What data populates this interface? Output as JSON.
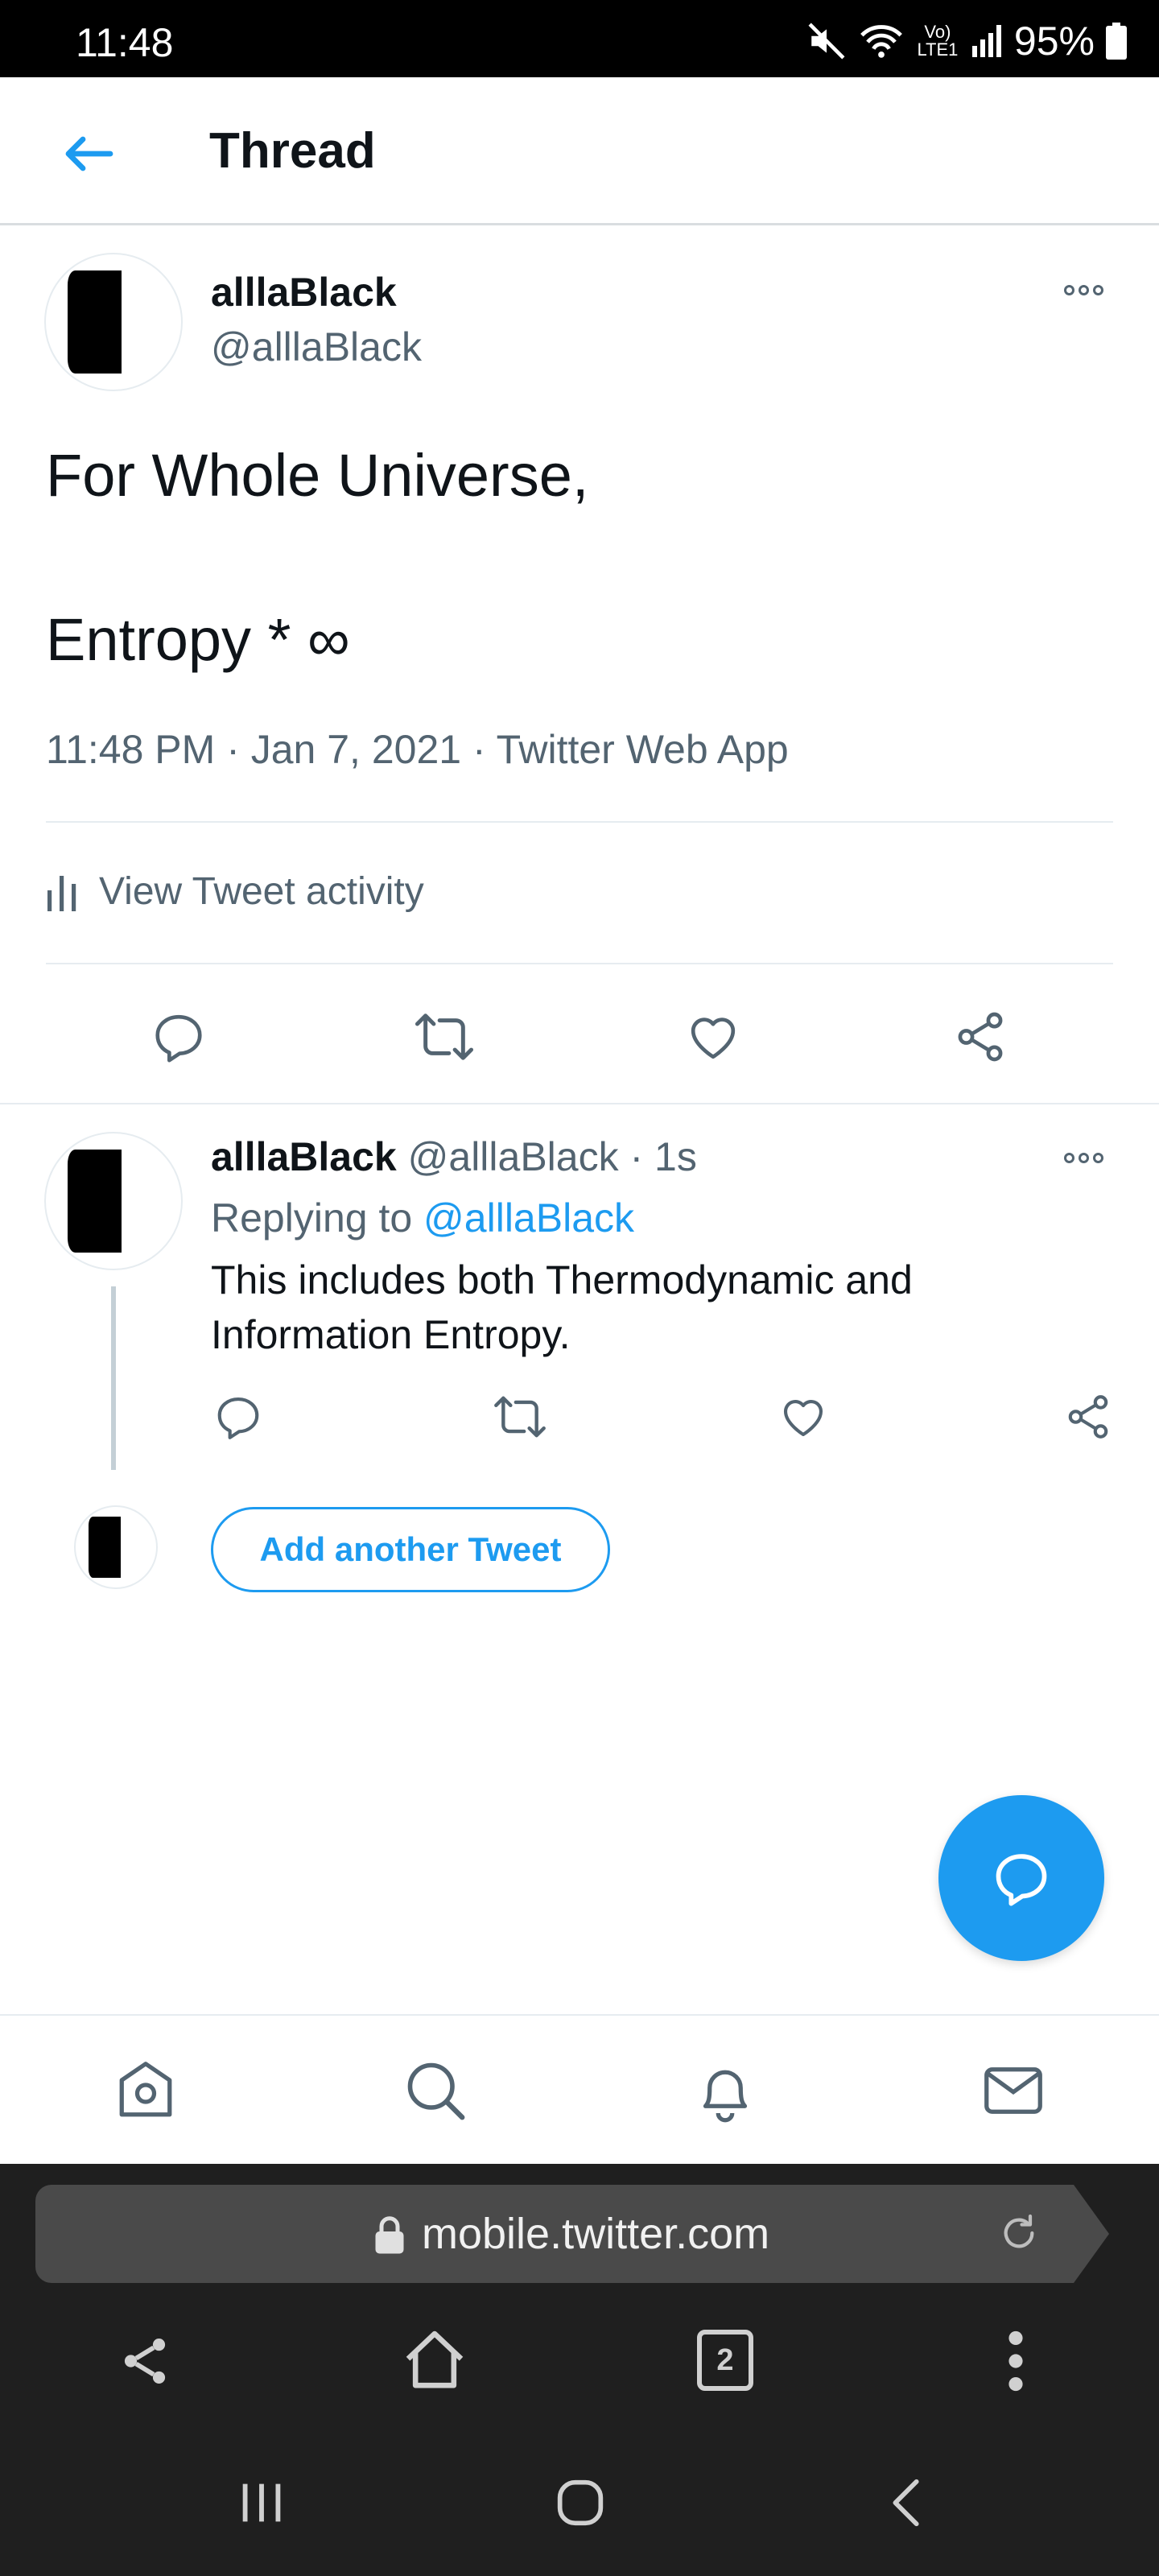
{
  "status_bar": {
    "time": "11:48",
    "battery": "95%",
    "network": "Vo) LTE1"
  },
  "header": {
    "title": "Thread"
  },
  "main_tweet": {
    "name": "alllaBlack",
    "handle": "@alllaBlack",
    "text_line1": "For Whole Universe,",
    "text_line2": "Entropy * ∞",
    "meta": "11:48 PM · Jan 7, 2021 · Twitter Web App",
    "activity_label": "View Tweet activity"
  },
  "reply": {
    "name": "alllaBlack",
    "handle_time": "@alllaBlack · 1s",
    "replying_prefix": "Replying to ",
    "replying_mention": "@alllaBlack",
    "text": "This includes both Thermodynamic and Information Entropy."
  },
  "add_tweet": {
    "label": "Add another Tweet"
  },
  "browser": {
    "url": "mobile.twitter.com",
    "tab_count": "2"
  },
  "colors": {
    "accent": "#1d9bf0",
    "secondary_text": "#536471",
    "primary_text": "#0f1419"
  },
  "icons": {
    "bottom_nav": [
      "home-icon",
      "search-icon",
      "notifications-icon",
      "messages-icon"
    ],
    "tweet_actions": [
      "reply-icon",
      "retweet-icon",
      "like-icon",
      "share-icon"
    ]
  }
}
